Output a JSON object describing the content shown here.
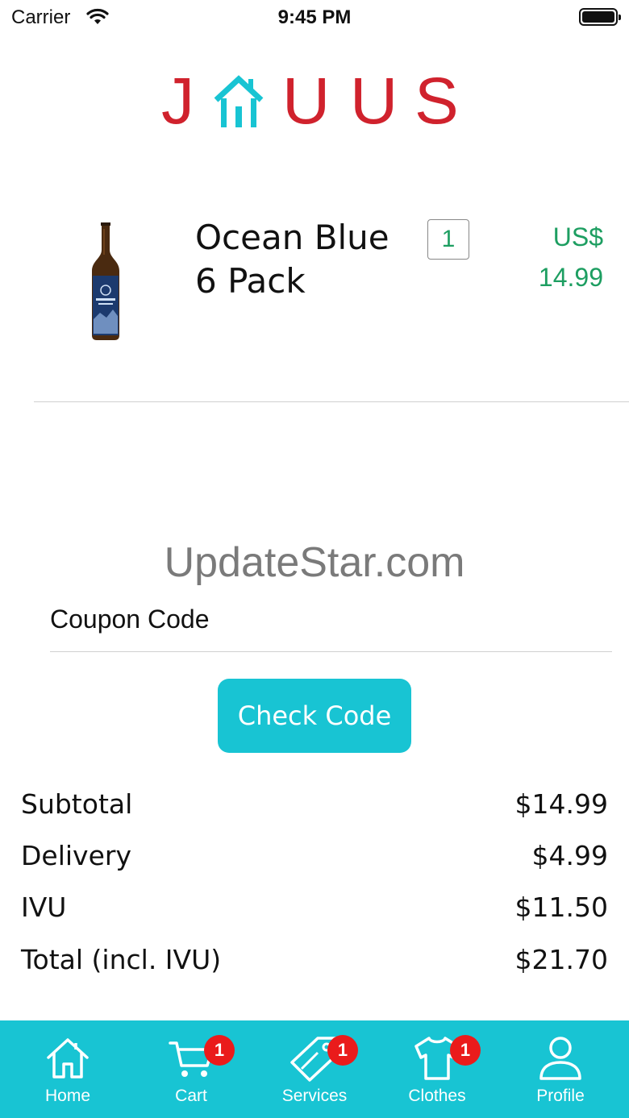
{
  "status_bar": {
    "carrier": "Carrier",
    "time": "9:45 PM"
  },
  "logo": {
    "letters": [
      "J",
      "",
      "U",
      "U",
      "S"
    ],
    "brand_color": "#d0222d",
    "accent_color": "#18c4d3"
  },
  "cart_item": {
    "name_line1": "Ocean Blue",
    "name_line2": "6 Pack",
    "quantity": "1",
    "currency": "US$",
    "price": "14.99",
    "price_color": "#1d9e61"
  },
  "watermark": "UpdateStar.com",
  "coupon": {
    "placeholder": "Coupon Code",
    "button_label": "Check Code"
  },
  "summary": [
    {
      "label": "Subtotal",
      "value": "$14.99"
    },
    {
      "label": "Delivery",
      "value": "$4.99"
    },
    {
      "label": "IVU",
      "value": "$11.50"
    },
    {
      "label": "Total (incl. IVU)",
      "value": "$21.70"
    }
  ],
  "tabs": [
    {
      "label": "Home",
      "icon": "home-icon",
      "badge": ""
    },
    {
      "label": "Cart",
      "icon": "cart-icon",
      "badge": "1"
    },
    {
      "label": "Services",
      "icon": "tag-icon",
      "badge": "1"
    },
    {
      "label": "Clothes",
      "icon": "shirt-icon",
      "badge": "1"
    },
    {
      "label": "Profile",
      "icon": "person-icon",
      "badge": ""
    }
  ]
}
